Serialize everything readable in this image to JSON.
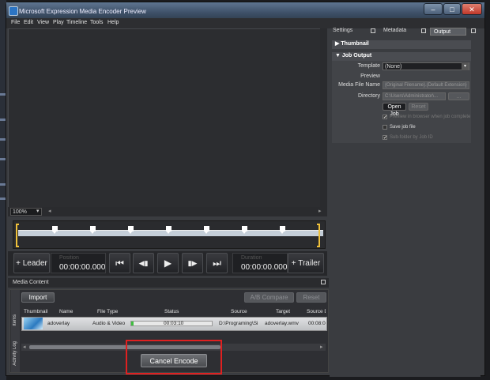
{
  "window": {
    "title": "Microsoft Expression Media Encoder Preview",
    "controls": {
      "minimize": "–",
      "maximize": "□",
      "close": "✕"
    }
  },
  "menu": [
    "File",
    "Edit",
    "View",
    "Play",
    "Timeline",
    "Tools",
    "Help"
  ],
  "preview": {
    "zoom": "100%",
    "zoom_arrow": "▾"
  },
  "transport": {
    "leader": "+ Leader",
    "trailer": "+ Trailer",
    "position_label": "Position",
    "position_value": "00:00:00.000",
    "duration_label": "Duration",
    "duration_value": "00:00:00.000",
    "icons": {
      "prev": "⏮",
      "step_back": "◀▮",
      "play": "▶",
      "step_fwd": "▮▶",
      "next": "⏭"
    }
  },
  "right_panel": {
    "tabs": [
      "Settings",
      "Metadata",
      "Output"
    ],
    "active_tab": "Output",
    "thumbnail_section": {
      "title": "Thumbnail",
      "arrow": "▶"
    },
    "job_output": {
      "title": "Job Output",
      "arrow": "▼",
      "template_label": "Template",
      "template_value": "(None)",
      "preview_label": "Preview",
      "media_file_name_label": "Media File Name",
      "media_file_name_value": "{Original Filename}.{Default Extension}",
      "directory_label": "Directory",
      "directory_value": "C:\\Users\\Administrator\\...",
      "browse_label": "...",
      "open_job_label": "Open Job",
      "reset_label": "Reset",
      "preview_in_browser_label": "Preview in browser when job complete",
      "save_job_file_label": "Save job file",
      "sub_folder_label": "Sub-folder by Job ID",
      "check_mark": "✔"
    }
  },
  "media_content": {
    "title": "Media Content",
    "import_label": "Import",
    "ab_compare_label": "A/B Compare",
    "reset_label": "Reset",
    "vertical_tabs": [
      "Items",
      "Activity Log"
    ],
    "columns": [
      "Thumbnail",
      "Name",
      "File Type",
      "Status",
      "Source",
      "Target",
      "Source D"
    ],
    "rows": [
      {
        "name": "adoverlay",
        "file_type": "Audio & Video",
        "status_time": "00:03:10",
        "status_progress": 0.03,
        "source": "D:\\Programing\\Si",
        "target": "adoverlay.wmv",
        "source_duration": "00:08:0"
      }
    ],
    "cancel_encode_label": "Cancel Encode"
  },
  "colors": {
    "highlight": "#e02020",
    "progress": "#3fbf3f",
    "timeline_bracket": "#f0c13a"
  }
}
